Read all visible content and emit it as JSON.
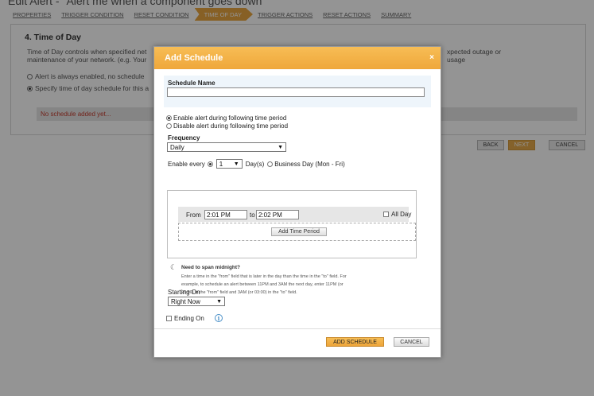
{
  "page": {
    "title": "Edit Alert - \"Alert me when a component goes down\"",
    "wizard_steps": [
      {
        "label": "PROPERTIES",
        "active": false
      },
      {
        "label": "TRIGGER CONDITION",
        "active": false
      },
      {
        "label": "RESET CONDITION",
        "active": false
      },
      {
        "label": "TIME OF DAY",
        "active": true
      },
      {
        "label": "TRIGGER ACTIONS",
        "active": false
      },
      {
        "label": "RESET ACTIONS",
        "active": false
      },
      {
        "label": "SUMMARY",
        "active": false
      }
    ],
    "section_title": "4. Time of Day",
    "description_line1": "Time of Day controls when specified net",
    "description_line1_right": "xpected outage or",
    "description_line2": "maintenance of your network. (e.g. Your",
    "description_line2_right": "usage",
    "option_always": "Alert is always enabled, no schedule",
    "option_specify": "Specify time of day schedule for this a",
    "no_schedule_text": "No schedule added yet...",
    "buttons": {
      "back": "BACK",
      "next": "NEXT",
      "cancel": "CANCEL"
    }
  },
  "modal": {
    "title": "Add Schedule",
    "close_icon": "×",
    "schedule_name_label": "Schedule Name",
    "schedule_name_value": "",
    "enable_option": "Enable alert during following time period",
    "disable_option": "Disable alert during following time period",
    "frequency_label": "Frequency",
    "frequency_value": "Daily",
    "enable_every_label": "Enable every",
    "every_value": "1",
    "days_label": "Day(s)",
    "business_day_label": "Business Day (Mon - Fri)",
    "from_label": "From",
    "from_value": "2:01 PM",
    "to_label": "to",
    "to_value": "2:02 PM",
    "all_day_label": "All Day",
    "add_time_period": "Add Time Period",
    "help_title": "Need to span midnight?",
    "help_lines": [
      "Enter a time in the \"from\" field that is later in the day than the time in the \"to\" field. For",
      "example, to schedule an alert between 11PM and 3AM the next day, enter 11PM (or",
      "23:00) in the \"from\" field and 3AM (or 03:00) in the \"to\" field."
    ],
    "starting_on_label": "Starting On",
    "starting_on_value": "Right Now",
    "ending_on_label": "Ending On",
    "info_icon": "i",
    "add_schedule_button": "ADD SCHEDULE",
    "cancel_button": "CANCEL"
  },
  "colors": {
    "accent": "#efa73b",
    "warning_text": "#c43d2f",
    "info_blue": "#4a90c8"
  }
}
